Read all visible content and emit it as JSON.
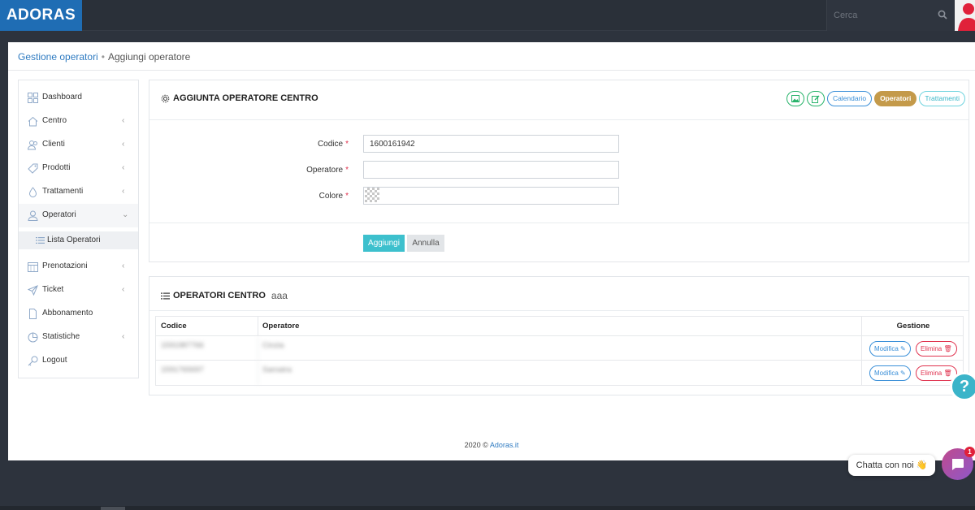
{
  "app": {
    "logo": "ADORAS"
  },
  "search": {
    "placeholder": "Cerca"
  },
  "breadcrumb": {
    "parent": "Gestione operatori",
    "separator": "•",
    "current": "Aggiungi operatore"
  },
  "sidebar": {
    "items": [
      {
        "label": "Dashboard",
        "icon": "dashboard-icon",
        "chevron": ""
      },
      {
        "label": "Centro",
        "icon": "home-icon",
        "chevron": "‹"
      },
      {
        "label": "Clienti",
        "icon": "users-icon",
        "chevron": "‹"
      },
      {
        "label": "Prodotti",
        "icon": "tag-icon",
        "chevron": "‹"
      },
      {
        "label": "Trattamenti",
        "icon": "drop-icon",
        "chevron": "‹"
      },
      {
        "label": "Operatori",
        "icon": "user-icon",
        "chevron": "⌄"
      },
      {
        "label": "Prenotazioni",
        "icon": "calendar-icon",
        "chevron": "‹"
      },
      {
        "label": "Ticket",
        "icon": "send-icon",
        "chevron": "‹"
      },
      {
        "label": "Abbonamento",
        "icon": "document-icon",
        "chevron": ""
      },
      {
        "label": "Statistiche",
        "icon": "pie-icon",
        "chevron": "‹"
      },
      {
        "label": "Logout",
        "icon": "key-icon",
        "chevron": ""
      }
    ],
    "sub_item": {
      "label": "Lista Operatori",
      "icon": "list-icon"
    }
  },
  "form_card": {
    "title": "AGGIUNTA OPERATORE CENTRO",
    "toolbar": {
      "image_btn": "image-icon",
      "edit_btn": "edit-icon",
      "calendario": "Calendario",
      "operatori": "Operatori",
      "trattamenti": "Trattamenti"
    },
    "fields": {
      "codice_label": "Codice",
      "codice_value": "1600161942",
      "operatore_label": "Operatore",
      "operatore_value": "",
      "colore_label": "Colore",
      "required_mark": "*"
    },
    "buttons": {
      "add": "Aggiungi",
      "cancel": "Annulla"
    }
  },
  "list_card": {
    "title": "OPERATORI CENTRO",
    "subtitle": "aaa",
    "headers": {
      "code": "Codice",
      "operator": "Operatore",
      "actions": "Gestione"
    },
    "rows": [
      {
        "code": "1591987766",
        "operator": "Cinzia"
      },
      {
        "code": "1591765697",
        "operator": "Samatra"
      }
    ],
    "actions": {
      "edit": "Modifica",
      "delete": "Elimina"
    }
  },
  "footer": {
    "text": "2020 ©",
    "link": "Adoras.it"
  },
  "chat": {
    "label": "Chatta con noi",
    "emoji": "👋",
    "badge": "1"
  },
  "help": {
    "symbol": "?"
  },
  "colors": {
    "brand": "#1f6db4",
    "accent_teal": "#3dc0cd",
    "accent_gold": "#c49a4a",
    "danger": "#e0334f"
  }
}
